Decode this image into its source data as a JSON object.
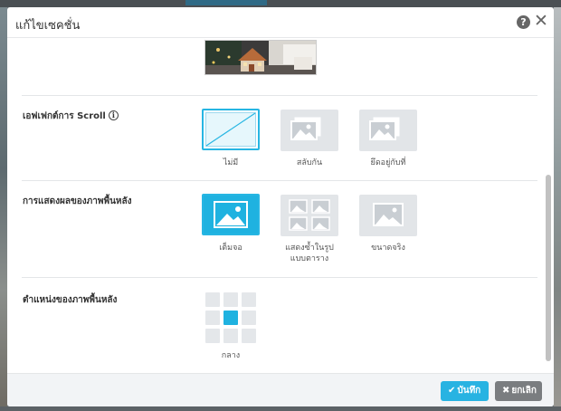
{
  "dialog": {
    "title": "แก้ไขเซคชั่น",
    "help_icon": "?",
    "close_icon": "✕"
  },
  "sections": {
    "scroll_effect": {
      "label": "เอฟเฟกต์การ Scroll",
      "info_icon": "i",
      "options": [
        {
          "label": "ไม่มี",
          "selected": true
        },
        {
          "label": "สลับกัน",
          "selected": false
        },
        {
          "label": "ยึดอยู่กับที่",
          "selected": false
        }
      ]
    },
    "bg_display": {
      "label": "การแสดงผลของภาพพื้นหลัง",
      "options": [
        {
          "label": "เต็มจอ",
          "selected": true
        },
        {
          "label": "แสดงซ้ำในรูปแบบตาราง",
          "selected": false
        },
        {
          "label": "ขนาดจริง",
          "selected": false
        }
      ]
    },
    "bg_position": {
      "label": "ตำแหน่งของภาพพื้นหลัง",
      "selected_label": "กลาง",
      "selected_cell": 4
    }
  },
  "footer": {
    "save_label": "บันทึก",
    "cancel_label": "ยกเลิก",
    "save_icon": "✔",
    "cancel_icon": "✖"
  },
  "colors": {
    "accent": "#27b6e3",
    "option_bg": "#e2e5e8",
    "cancel_bg": "#7a7d80"
  }
}
